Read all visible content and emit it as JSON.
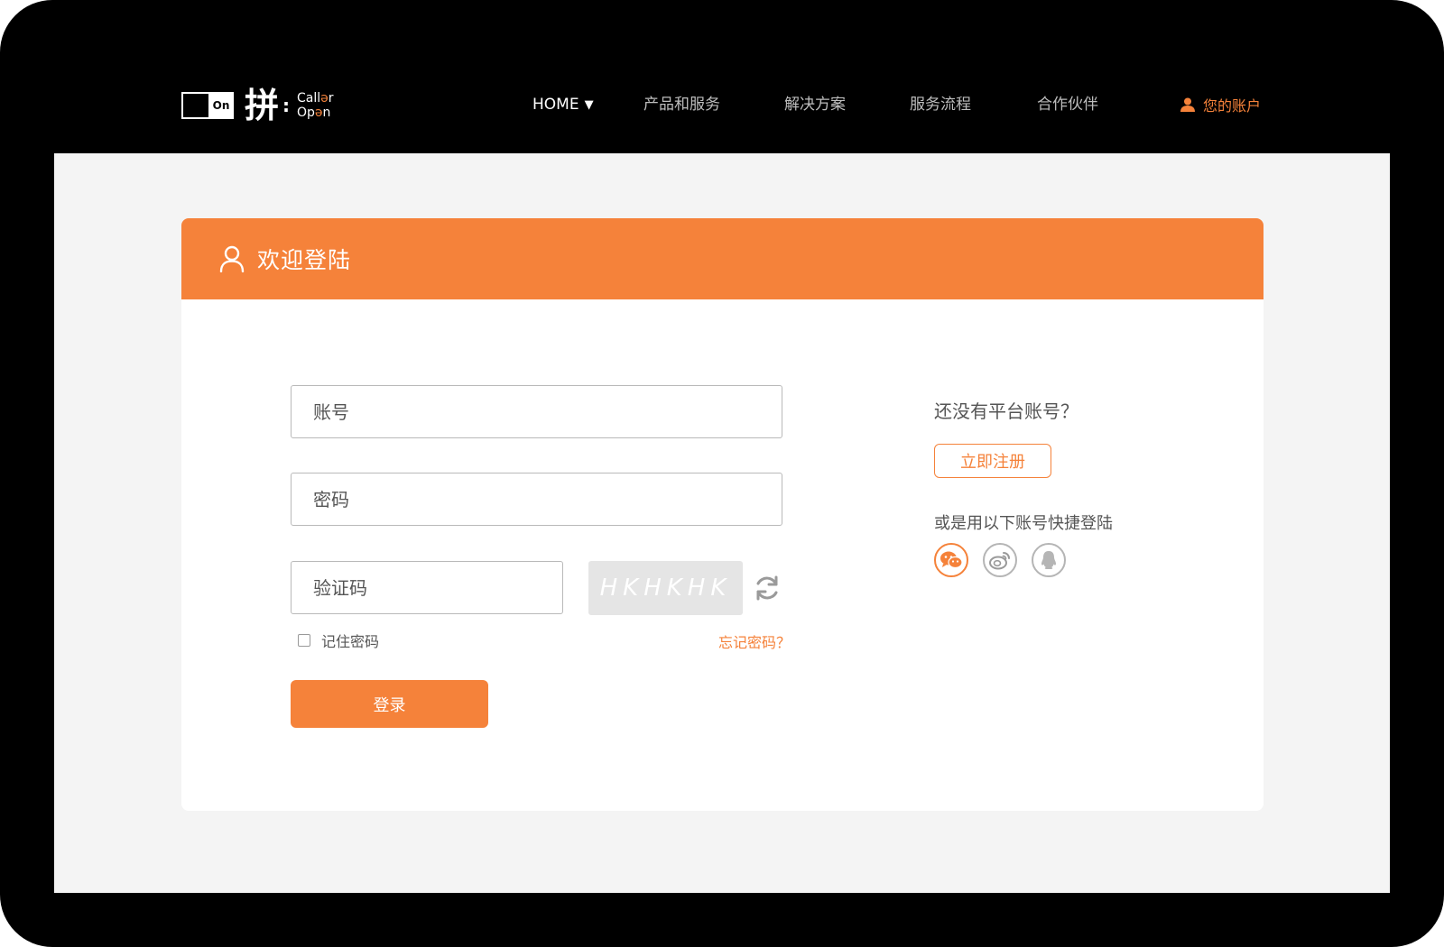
{
  "brand": {
    "logo_box_text": "On",
    "logo_glyph": "拼",
    "logo_colon": ":",
    "logo_word_1_a": "Call",
    "logo_word_1_b": "ə",
    "logo_word_1_c": "r",
    "logo_word_2_a": "Op",
    "logo_word_2_b": "ə",
    "logo_word_2_c": "n"
  },
  "nav": {
    "items": [
      {
        "label": "HOME",
        "active": true,
        "caret": "▼"
      },
      {
        "label": "产品和服务"
      },
      {
        "label": "解决方案"
      },
      {
        "label": "服务流程"
      },
      {
        "label": "合作伙伴"
      }
    ],
    "account_label": "您的账户",
    "account_icon": "user-icon"
  },
  "login": {
    "title": "欢迎登陆",
    "title_icon": "user-outline-icon",
    "account_placeholder": "账号",
    "password_placeholder": "密码",
    "captcha_placeholder": "验证码",
    "captcha_text": "HKHKHK",
    "refresh_icon": "refresh-icon",
    "remember_label": "记住密码",
    "remember_checked": false,
    "forgot_label": "忘记密码？",
    "submit_label": "登录"
  },
  "register": {
    "question": "还没有平台账号？",
    "button_label": "立即注册",
    "quick_login_label": "或是用以下账号快捷登陆",
    "social_icons": [
      "wechat-icon",
      "weibo-icon",
      "qq-icon"
    ]
  },
  "colors": {
    "accent": "#f5823a",
    "header_bg": "#000000",
    "content_bg": "#f4f4f4",
    "captcha_bg": "#e5e5e5"
  }
}
